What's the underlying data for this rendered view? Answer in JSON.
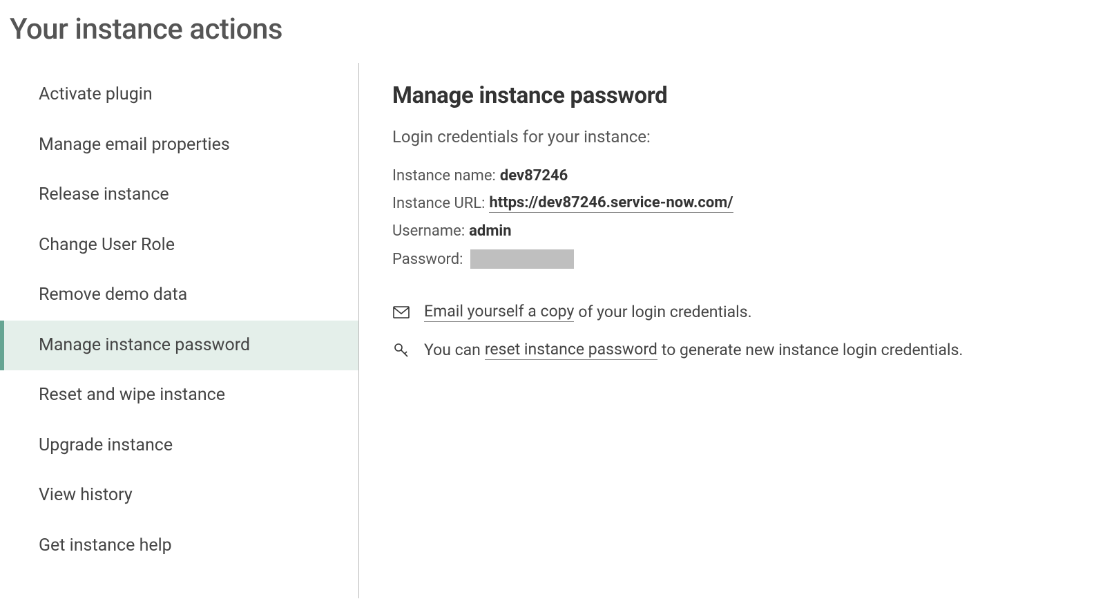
{
  "page_title": "Your instance actions",
  "sidebar": {
    "items": [
      {
        "label": "Activate plugin",
        "active": false
      },
      {
        "label": "Manage email properties",
        "active": false
      },
      {
        "label": "Release instance",
        "active": false
      },
      {
        "label": "Change User Role",
        "active": false
      },
      {
        "label": "Remove demo data",
        "active": false
      },
      {
        "label": "Manage instance password",
        "active": true
      },
      {
        "label": "Reset and wipe instance",
        "active": false
      },
      {
        "label": "Upgrade instance",
        "active": false
      },
      {
        "label": "View history",
        "active": false
      },
      {
        "label": "Get instance help",
        "active": false
      }
    ]
  },
  "main": {
    "title": "Manage instance password",
    "subtitle": "Login credentials for your instance:",
    "credentials": {
      "instance_name_label": "Instance name:",
      "instance_name_value": "dev87246",
      "instance_url_label": "Instance URL:",
      "instance_url_value": "https://dev87246.service-now.com/",
      "username_label": "Username:",
      "username_value": "admin",
      "password_label": "Password:"
    },
    "email_action": {
      "link_text": "Email yourself a copy",
      "suffix_text": " of your login credentials."
    },
    "reset_action": {
      "prefix_text": "You can ",
      "link_text": "reset instance password",
      "suffix_text": " to generate new instance login credentials."
    }
  }
}
